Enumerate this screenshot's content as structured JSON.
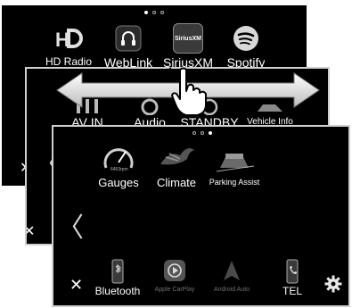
{
  "screens": {
    "back": {
      "apps": [
        {
          "label": "HD Radio",
          "icon": "hd-radio-icon"
        },
        {
          "label": "WebLink",
          "icon": "weblink-icon"
        },
        {
          "label": "SiriusXM",
          "icon": "siriusxm-icon"
        },
        {
          "label": "Spotify",
          "icon": "spotify-icon"
        }
      ],
      "siriusxm_badge": "SiriusXM"
    },
    "middle": {
      "apps": [
        {
          "label": "AV IN"
        },
        {
          "label": "Audio"
        },
        {
          "label": "STANDBY"
        },
        {
          "label": "Vehicle Info"
        }
      ]
    },
    "front": {
      "apps": [
        {
          "label": "Gauges"
        },
        {
          "label": "Climate"
        },
        {
          "label": "Parking Assist"
        }
      ],
      "gauge_text": "6453rpm",
      "dock": {
        "close": "✕",
        "items": [
          {
            "label": "Bluetooth"
          },
          {
            "label": "Apple CarPlay"
          },
          {
            "label": "Android Auto"
          },
          {
            "label": "TEL"
          }
        ]
      }
    }
  },
  "nav": {
    "prev": "〈"
  },
  "colors": {
    "background": "#000000",
    "text": "#ffffff",
    "dim_text": "#6f6f6f",
    "frame": "#cfcfcf"
  }
}
